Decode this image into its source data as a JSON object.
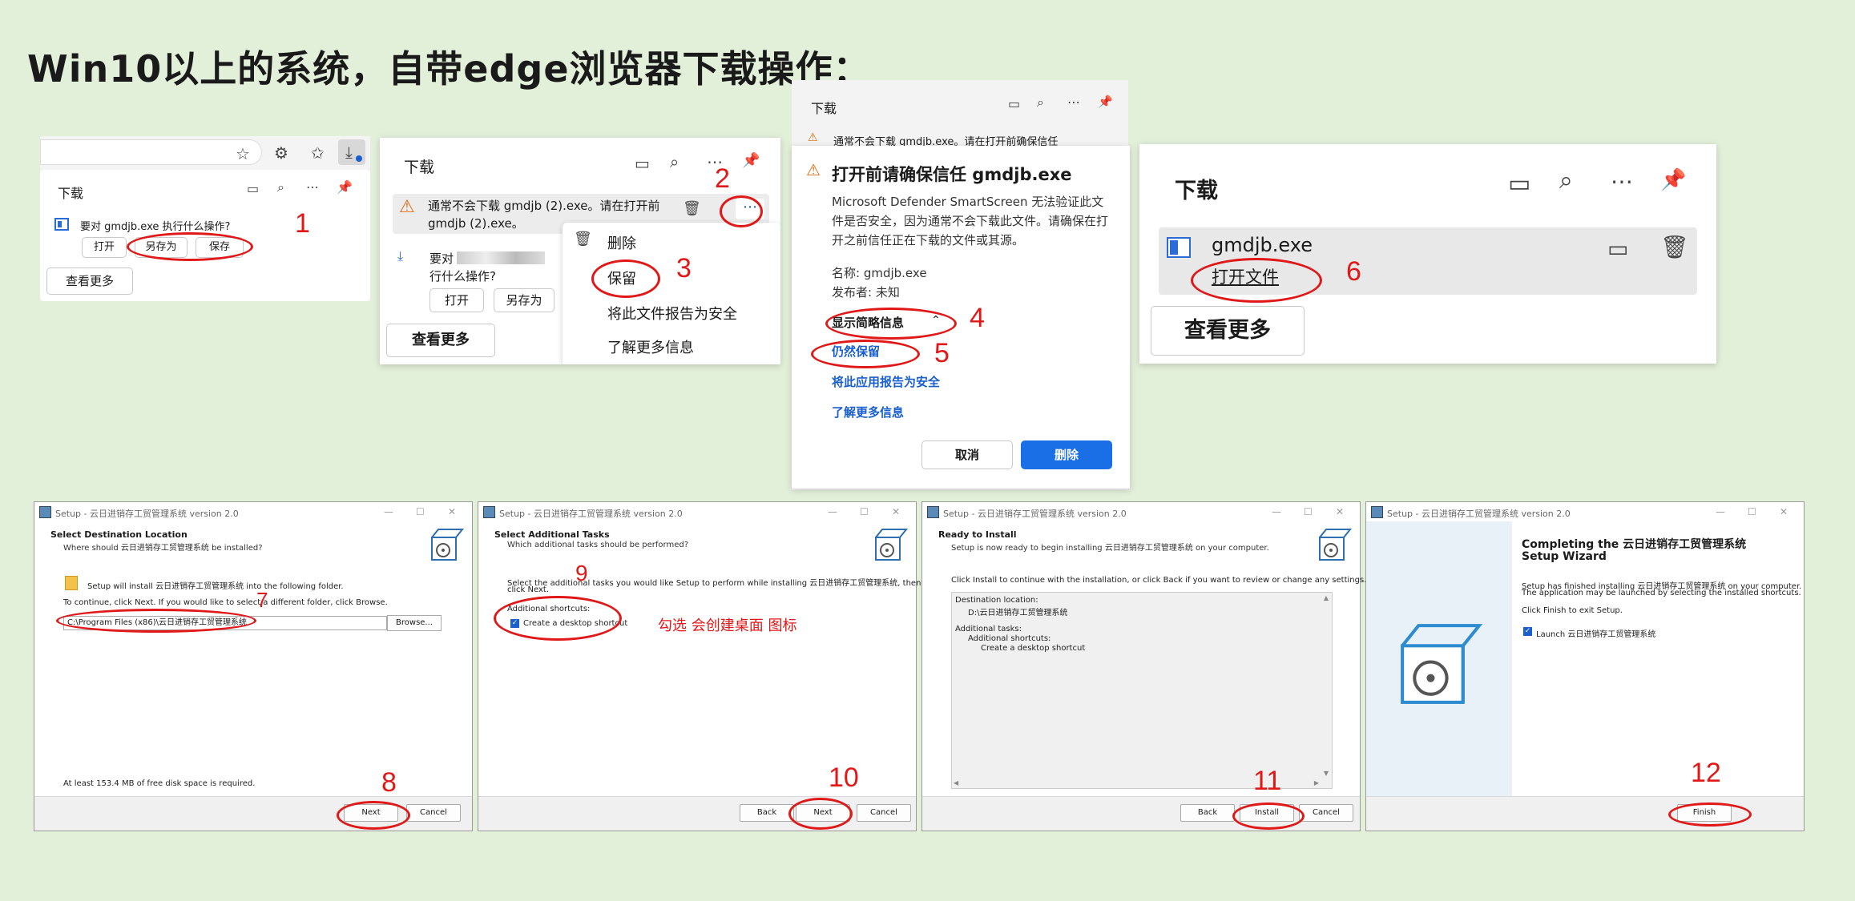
{
  "title": "Win10以上的系统，自带edge浏览器下载操作：",
  "p1": {
    "heading": "下载",
    "prompt": "要对 gmdjb.exe 执行什么操作?",
    "btn_open": "打开",
    "btn_saveas": "另存为",
    "btn_save": "保存",
    "btn_more": "查看更多",
    "step": "1"
  },
  "p2": {
    "heading": "下载",
    "warning": "通常不会下载 gmdjb (2).exe。请在打开前",
    "filename": "gmdjb (2).exe。",
    "second_line1": "要对",
    "second_line2": "行什么操作?",
    "btn_open": "打开",
    "btn_saveas": "另存为",
    "btn_more": "查看更多",
    "menu": [
      "删除",
      "保留",
      "将此文件报告为安全",
      "了解更多信息"
    ],
    "step2": "2",
    "step3": "3"
  },
  "p3": {
    "heading": "下载",
    "bg_warning": "通常不会下载 gmdjb.exe。请在打开前确保信任",
    "title": "打开前请确保信任 gmdjb.exe",
    "body": "Microsoft Defender SmartScreen 无法验证此文件是否安全，因为通常不会下载此文件。请确保在打开之前信任正在下载的文件或其源。",
    "name_label": "名称: gmdjb.exe",
    "publisher_label": "发布者: 未知",
    "show_details": "显示简略信息",
    "keep_anyway": "仍然保留",
    "report_safe": "将此应用报告为安全",
    "learn_more": "了解更多信息",
    "cancel": "取消",
    "delete": "删除",
    "step4": "4",
    "step5": "5"
  },
  "p4": {
    "heading": "下载",
    "filename": "gmdjb.exe",
    "open_file": "打开文件",
    "btn_more": "查看更多",
    "step": "6"
  },
  "setup": {
    "window_title": "Setup - 云日进销存工贸管理系统 version 2.0",
    "w1": {
      "header": "Select Destination Location",
      "sub": "Where should 云日进销存工贸管理系统 be installed?",
      "line1": "Setup will install 云日进销存工贸管理系统 into the following folder.",
      "line2": "To continue, click Next. If you would like to select a different folder, click Browse.",
      "path": "C:\\Program Files (x86)\\云日进销存工贸管理系统",
      "browse": "Browse...",
      "disk": "At least 153.4 MB of free disk space is required.",
      "next": "Next",
      "cancel": "Cancel",
      "step7": "7",
      "step8": "8"
    },
    "w2": {
      "header": "Select Additional Tasks",
      "sub": "Which additional tasks should be performed?",
      "line1": "Select the additional tasks you would like Setup to perform while installing 云日进销存工贸管理系统, then",
      "line1b": "click Next.",
      "group": "Additional shortcuts:",
      "checkbox": "Create a desktop shortcut",
      "note": "勾选 会创建桌面 图标",
      "back": "Back",
      "next": "Next",
      "cancel": "Cancel",
      "step9": "9",
      "step10": "10"
    },
    "w3": {
      "header": "Ready to Install",
      "sub": "Setup is now ready to begin installing 云日进销存工贸管理系统 on your computer.",
      "line1": "Click Install to continue with the installation, or click Back if you want to review or change any settings.",
      "memo": [
        "Destination location:",
        "D:\\云日进销存工贸管理系统",
        "",
        "Additional tasks:",
        "Additional shortcuts:",
        "Create a desktop shortcut"
      ],
      "back": "Back",
      "install": "Install",
      "cancel": "Cancel",
      "step11": "11"
    },
    "w4": {
      "header1": "Completing the 云日进销存工贸管理系统",
      "header2": "Setup Wizard",
      "line1": "Setup has finished installing 云日进销存工贸管理系统 on your computer.",
      "line2": "The application may be launched by selecting the installed shortcuts.",
      "line3": "Click Finish to exit Setup.",
      "checkbox": "Launch 云日进销存工贸管理系统",
      "finish": "Finish",
      "step12": "12"
    }
  }
}
